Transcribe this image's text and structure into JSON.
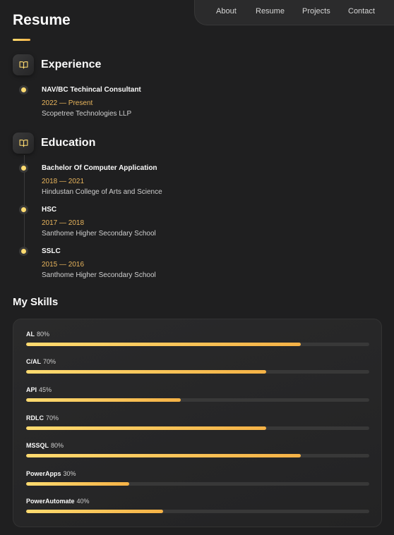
{
  "nav": {
    "items": [
      "About",
      "Resume",
      "Projects",
      "Contact"
    ],
    "active": "Resume"
  },
  "page": {
    "title": "Resume"
  },
  "experience": {
    "title": "Experience",
    "icon": "book-icon",
    "items": [
      {
        "title": "NAV/BC Techincal Consultant",
        "date": "2022 — Present",
        "sub": "Scopetree Technologies LLP"
      }
    ]
  },
  "education": {
    "title": "Education",
    "icon": "book-icon",
    "items": [
      {
        "title": "Bachelor Of Computer Application",
        "date": "2018 — 2021",
        "sub": "Hindustan College of Arts and Science"
      },
      {
        "title": "HSC",
        "date": "2017 — 2018",
        "sub": "Santhome Higher Secondary School"
      },
      {
        "title": "SSLC",
        "date": "2015 — 2016",
        "sub": "Santhome Higher Secondary School"
      }
    ]
  },
  "skills": {
    "title": "My Skills",
    "items": [
      {
        "name": "AL",
        "percent_label": "80%",
        "value": 80
      },
      {
        "name": "C/AL",
        "percent_label": "70%",
        "value": 70
      },
      {
        "name": "API",
        "percent_label": "45%",
        "value": 45
      },
      {
        "name": "RDLC",
        "percent_label": "70%",
        "value": 70
      },
      {
        "name": "MSSQL",
        "percent_label": "80%",
        "value": 80
      },
      {
        "name": "PowerApps",
        "percent_label": "30%",
        "value": 30
      },
      {
        "name": "PowerAutomate",
        "percent_label": "40%",
        "value": 40
      }
    ]
  },
  "colors": {
    "accent": "#ffdb70",
    "accent_dark": "#f5b246",
    "background": "#1f1f20",
    "date_text": "#e9b55c"
  }
}
